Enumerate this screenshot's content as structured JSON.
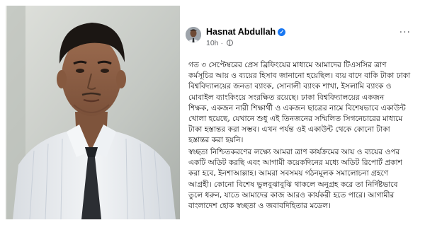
{
  "post": {
    "author": "Hasnat Abdullah",
    "verified_badge": "✓",
    "time": "10h",
    "time_separator": "·",
    "more_options": "···",
    "paragraphs": [
      [
        "গত ৩ সেপ্টেম্বরের প্রেস ব্রিফিংয়ের মাধ্যমে আমাদের টিএসসির ত্রাণ",
        "কর্মসূচির আয় ও ব্যয়ের হিসাব জানানো হয়েছিল। ব্যয় বাদে বাকি টাকা ঢাকা",
        "বিশ্ববিদ্যালয়ের জনতা ব্যাংক, সোনালী ব্যাংক শাখা, ইসলামি ব্যাংক ও",
        "মোবাইল ব্যাংকিংয়ে সংরক্ষিত রয়েছে। ঢাকা বিশ্ববিদ্যালয়ের একজন",
        "শিক্ষক, একজন নারী শিক্ষার্থী ও একজন ছাত্রের নামে বিশেষভাবে একাউন্ট",
        "খোলা হয়েছে, যেখানে শুধু এই তিনজনের সম্মিলিত সিগনেচারের মাধ্যমে",
        "টাকা হস্তান্তর করা সম্ভব। এখন পর্যন্ত ওই একাউন্ট থেকে কোনো টাকা",
        "হস্তান্তর করা হয়নি।"
      ],
      [
        "স্বচ্ছতা নিশ্চিতকরণের লক্ষ্যে আমরা ত্রাণ কার্যক্রমের আয় ও ব্যয়ের ওপর",
        "একটি অডিট করছি এবং আগামী কয়েকদিনের মধ্যে অডিট রিপোর্ট প্রকাশ",
        "করা হবে, ইনশাআল্লাহ। আমরা সবসময় গঠনমূলক সমালোচনা গ্রহণে",
        "আগ্রহী। কোনো বিশেষ ভুলবুঝাবুঝি থাকলে অনুগ্রহ করে তা নির্দিষ্টভাবে",
        "তুলে ধরুন, যাতে আমাদের কাজ আরও কার্যকরী হতে পারে। আগামীর",
        "বাংলাদেশ হোক স্বচ্ছতা ও জবাবদিহিতার মডেল।"
      ]
    ]
  },
  "colors": {
    "author": "#050505",
    "meta": "#65676b",
    "verified": "#1877f2",
    "body_text": "#111111"
  },
  "icons": {
    "verified": "verified-badge-icon",
    "privacy": "globe-icon",
    "more": "more-options-icon"
  }
}
